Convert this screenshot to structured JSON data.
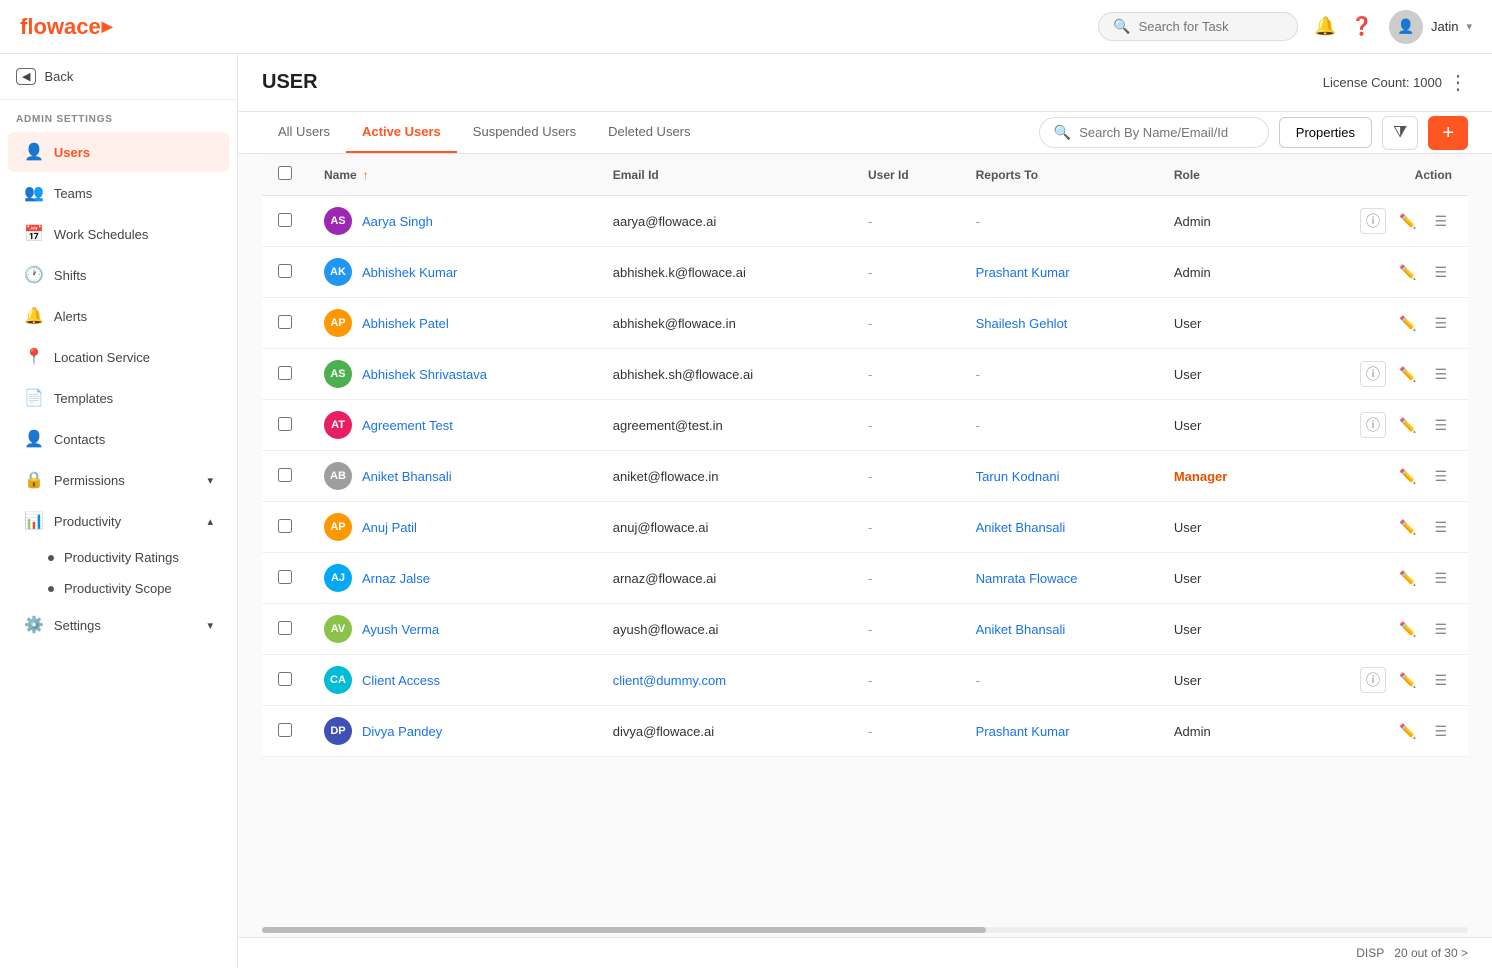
{
  "app": {
    "logo_text": "flowace",
    "logo_accent": "▶"
  },
  "topbar": {
    "search_placeholder": "Search for Task",
    "user_name": "Jatin",
    "chevron": "▾"
  },
  "sidebar": {
    "back_label": "Back",
    "admin_label": "ADMIN SETTINGS",
    "items": [
      {
        "id": "users",
        "label": "Users",
        "icon": "👤",
        "active": true
      },
      {
        "id": "teams",
        "label": "Teams",
        "icon": "👥",
        "active": false
      },
      {
        "id": "work-schedules",
        "label": "Work Schedules",
        "icon": "📅",
        "active": false
      },
      {
        "id": "shifts",
        "label": "Shifts",
        "icon": "🕐",
        "active": false
      },
      {
        "id": "alerts",
        "label": "Alerts",
        "icon": "🔔",
        "active": false
      },
      {
        "id": "location-service",
        "label": "Location Service",
        "icon": "📍",
        "active": false
      },
      {
        "id": "templates",
        "label": "Templates",
        "icon": "📄",
        "active": false
      },
      {
        "id": "contacts",
        "label": "Contacts",
        "icon": "👤",
        "active": false
      },
      {
        "id": "permissions",
        "label": "Permissions",
        "icon": "🔒",
        "active": false,
        "has_chevron": true
      },
      {
        "id": "productivity",
        "label": "Productivity",
        "icon": "📊",
        "active": false,
        "expanded": true
      },
      {
        "id": "settings",
        "label": "Settings",
        "icon": "⚙️",
        "active": false,
        "has_chevron": true
      }
    ],
    "productivity_sub": [
      {
        "id": "productivity-ratings",
        "label": "Productivity Ratings"
      },
      {
        "id": "productivity-scope",
        "label": "Productivity Scope"
      }
    ]
  },
  "page": {
    "title": "USER",
    "license_label": "License Count: 1000"
  },
  "tabs": [
    {
      "id": "all-users",
      "label": "All Users",
      "active": false
    },
    {
      "id": "active-users",
      "label": "Active Users",
      "active": true
    },
    {
      "id": "suspended-users",
      "label": "Suspended Users",
      "active": false
    },
    {
      "id": "deleted-users",
      "label": "Deleted Users",
      "active": false
    }
  ],
  "search": {
    "placeholder": "Search By Name/Email/Id"
  },
  "toolbar": {
    "properties_label": "Properties",
    "filter_icon": "⧩",
    "add_icon": "+"
  },
  "table": {
    "columns": [
      "Name",
      "Email Id",
      "User Id",
      "Reports To",
      "Role",
      "Action"
    ],
    "rows": [
      {
        "initials": "AS",
        "color": "#9c27b0",
        "name": "Aarya Singh",
        "email": "aarya@flowace.ai",
        "user_id": "-",
        "reports_to": "-",
        "role": "Admin",
        "has_info": true,
        "reports_link": false
      },
      {
        "initials": "AK",
        "color": "#2196f3",
        "name": "Abhishek Kumar",
        "email": "abhishek.k@flowace.ai",
        "user_id": "-",
        "reports_to": "Prashant Kumar",
        "role": "Admin",
        "has_info": false,
        "reports_link": false
      },
      {
        "initials": "AP",
        "color": "#ff9800",
        "name": "Abhishek Patel",
        "email": "abhishek@flowace.in",
        "user_id": "-",
        "reports_to": "Shailesh Gehlot",
        "role": "User",
        "has_info": false,
        "reports_link": false
      },
      {
        "initials": "AS",
        "color": "#4caf50",
        "name": "Abhishek Shrivastava",
        "email": "abhishek.sh@flowace.ai",
        "user_id": "-",
        "reports_to": "-",
        "role": "User",
        "has_info": true,
        "reports_link": false
      },
      {
        "initials": "AT",
        "color": "#e91e63",
        "name": "Agreement Test",
        "email": "agreement@test.in",
        "user_id": "-",
        "reports_to": "-",
        "role": "User",
        "has_info": true,
        "reports_link": false
      },
      {
        "initials": "AB",
        "color": "#9e9e9e",
        "name": "Aniket Bhansali",
        "email": "aniket@flowace.in",
        "user_id": "-",
        "reports_to": "Tarun Kodnani",
        "role": "Manager",
        "has_info": false,
        "reports_link": true
      },
      {
        "initials": "AP",
        "color": "#ff9800",
        "name": "Anuj Patil",
        "email": "anuj@flowace.ai",
        "user_id": "-",
        "reports_to": "Aniket Bhansali",
        "role": "User",
        "has_info": false,
        "reports_link": false
      },
      {
        "initials": "AJ",
        "color": "#03a9f4",
        "name": "Arnaz Jalse",
        "email": "arnaz@flowace.ai",
        "user_id": "-",
        "reports_to": "Namrata Flowace",
        "role": "User",
        "has_info": false,
        "reports_link": false
      },
      {
        "initials": "AV",
        "color": "#8bc34a",
        "name": "Ayush Verma",
        "email": "ayush@flowace.ai",
        "user_id": "-",
        "reports_to": "Aniket Bhansali",
        "role": "User",
        "has_info": false,
        "reports_link": false
      },
      {
        "initials": "CA",
        "color": "#00bcd4",
        "name": "Client Access",
        "email": "client@dummy.com",
        "user_id": "-",
        "reports_to": "-",
        "role": "User",
        "has_info": true,
        "reports_link": false
      },
      {
        "initials": "DP",
        "color": "#3f51b5",
        "name": "Divya Pandey",
        "email": "divya@flowace.ai",
        "user_id": "-",
        "reports_to": "Prashant Kumar",
        "role": "Admin",
        "has_info": false,
        "reports_link": false
      }
    ]
  },
  "footer": {
    "display_label": "DISP",
    "count_label": "20 out of 30 >"
  }
}
